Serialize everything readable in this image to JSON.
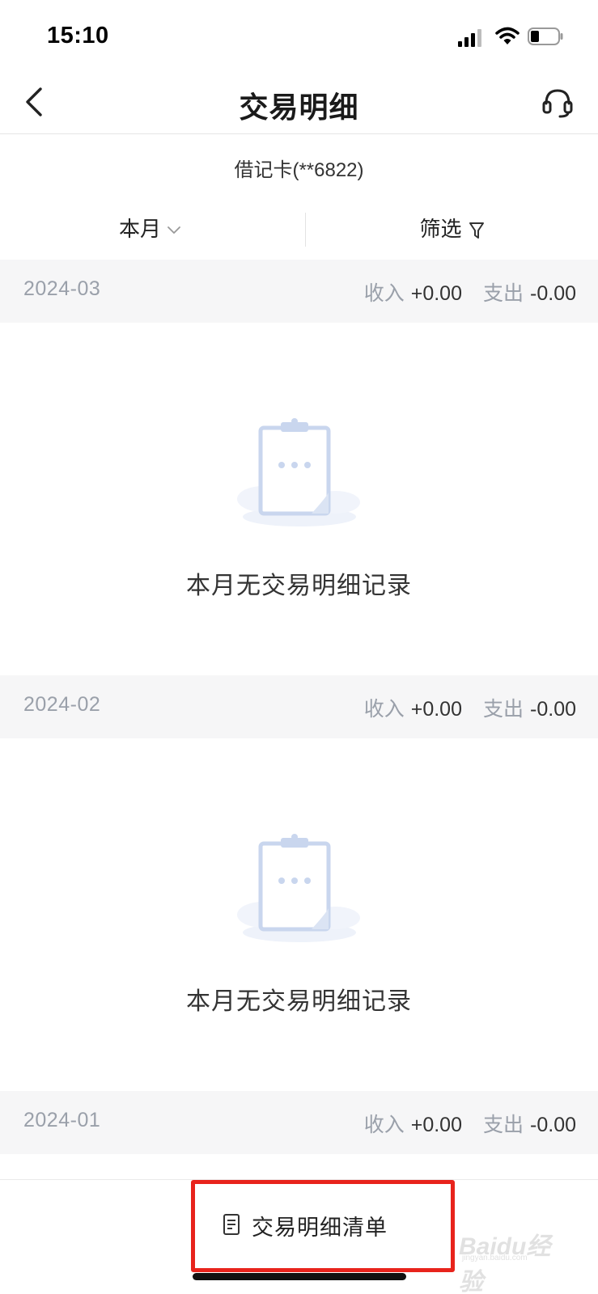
{
  "status_bar": {
    "time": "15:10"
  },
  "header": {
    "title": "交易明细"
  },
  "account": {
    "card_label": "借记卡(**6822)"
  },
  "filters": {
    "period_label": "本月",
    "filter_label": "筛选"
  },
  "months": [
    {
      "date": "2024-03",
      "income_label": "收入",
      "income_value": "+0.00",
      "expense_label": "支出",
      "expense_value": "-0.00",
      "empty_text": "本月无交易明细记录"
    },
    {
      "date": "2024-02",
      "income_label": "收入",
      "income_value": "+0.00",
      "expense_label": "支出",
      "expense_value": "-0.00",
      "empty_text": "本月无交易明细记录"
    },
    {
      "date": "2024-01",
      "income_label": "收入",
      "income_value": "+0.00",
      "expense_label": "支出",
      "expense_value": "-0.00"
    }
  ],
  "bottom": {
    "detail_list_label": "交易明细清单"
  },
  "watermark": {
    "text": "Baidu经验",
    "sub": "jingyan.baidu.com"
  },
  "colors": {
    "highlight_box": "#e8231c",
    "muted_text": "#9aa0aa",
    "section_bg": "#f6f6f7",
    "illustration": "#c9d6ee"
  },
  "icons": {
    "back": "chevron-left-icon",
    "service": "headset-icon",
    "dropdown": "chevron-down-icon",
    "filter": "funnel-icon",
    "empty": "clipboard-icon",
    "list": "document-icon"
  }
}
